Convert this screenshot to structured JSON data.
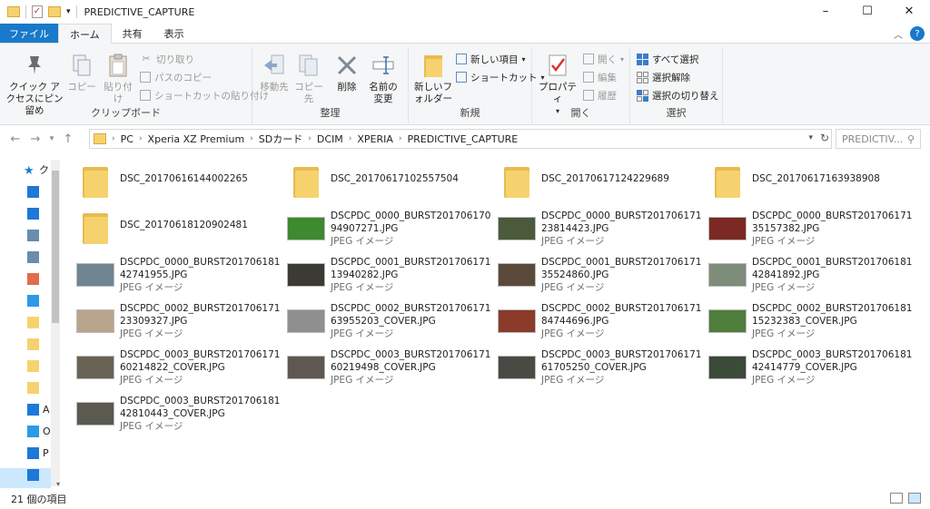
{
  "window": {
    "title": "PREDICTIVE_CAPTURE",
    "controls": [
      "–",
      "☐",
      "✕"
    ]
  },
  "ribbon_tabs": [
    "ファイル",
    "ホーム",
    "共有",
    "表示"
  ],
  "ribbon": {
    "clipboard": {
      "label": "クリップボード",
      "pin": "クイック アクセスにピン留め",
      "copy": "コピー",
      "paste": "貼り付け",
      "cut": "切り取り",
      "copy_path": "パスのコピー",
      "paste_shortcut": "ショートカットの貼り付け"
    },
    "organize": {
      "label": "整理",
      "move_to": "移動先",
      "copy_to": "コピー先",
      "delete": "削除",
      "rename": "名前の変更"
    },
    "new": {
      "label": "新規",
      "new_folder": "新しいフォルダー",
      "new_item": "新しい項目",
      "shortcut": "ショートカット"
    },
    "open": {
      "label": "開く",
      "properties": "プロパティ",
      "open": "開く",
      "edit": "編集",
      "history": "履歴"
    },
    "select": {
      "label": "選択",
      "select_all": "すべて選択",
      "select_none": "選択解除",
      "invert": "選択の切り替え"
    }
  },
  "address": {
    "crumbs": [
      "PC",
      "Xperia XZ Premium",
      "SDカード",
      "DCIM",
      "XPERIA",
      "PREDICTIVE_CAPTURE"
    ],
    "search_placeholder": "PREDICTIV..."
  },
  "navpane": {
    "items": [
      {
        "icon": "star-icon",
        "label": "ク",
        "color": "#1e78d7"
      },
      {
        "icon": "desktop-icon",
        "label": "",
        "color": "#1e78d7"
      },
      {
        "icon": "download-icon",
        "label": "",
        "color": "#1e78d7"
      },
      {
        "icon": "document-icon",
        "label": "",
        "color": "#6a8cad"
      },
      {
        "icon": "pictures-icon",
        "label": "",
        "color": "#6a8cad"
      },
      {
        "icon": "photos-icon",
        "label": "",
        "color": "#e26b4b"
      },
      {
        "icon": "onedrive-icon",
        "label": "",
        "color": "#2b9be6"
      },
      {
        "icon": "folder-icon",
        "label": "",
        "color": "#f6d26f"
      },
      {
        "icon": "folder-icon",
        "label": "",
        "color": "#f6d26f"
      },
      {
        "icon": "folder-icon",
        "label": "",
        "color": "#f6d26f"
      },
      {
        "icon": "folder-icon",
        "label": "",
        "color": "#f6d26f"
      },
      {
        "icon": "a-icon",
        "label": "A",
        "color": "#1e78d7"
      },
      {
        "icon": "cloud-icon",
        "label": "O",
        "color": "#2b9be6"
      },
      {
        "icon": "pc-icon",
        "label": "P",
        "color": "#1e78d7"
      },
      {
        "icon": "phone-icon",
        "label": "",
        "color": "#1e78d7"
      }
    ]
  },
  "files": [
    {
      "name": "DSC_20170616144002265",
      "type": "",
      "kind": "folder"
    },
    {
      "name": "DSC_20170617102557504",
      "type": "",
      "kind": "folder"
    },
    {
      "name": "DSC_20170617124229689",
      "type": "",
      "kind": "folder"
    },
    {
      "name": "DSC_20170617163938908",
      "type": "",
      "kind": "folder"
    },
    {
      "name": "DSC_20170618120902481",
      "type": "",
      "kind": "folder"
    },
    {
      "name": "DSCPDC_0000_BURST20170617094907271.JPG",
      "type": "JPEG イメージ",
      "kind": "photo",
      "color": "#3d8a2f"
    },
    {
      "name": "DSCPDC_0000_BURST20170617123814423.JPG",
      "type": "JPEG イメージ",
      "kind": "photo",
      "color": "#4a5a3a"
    },
    {
      "name": "DSCPDC_0000_BURST20170617135157382.JPG",
      "type": "JPEG イメージ",
      "kind": "photo",
      "color": "#7a2a22"
    },
    {
      "name": "DSCPDC_0000_BURST20170618142741955.JPG",
      "type": "JPEG イメージ",
      "kind": "photo",
      "color": "#6f8592"
    },
    {
      "name": "DSCPDC_0001_BURST20170617113940282.JPG",
      "type": "JPEG イメージ",
      "kind": "photo",
      "color": "#3b3a35"
    },
    {
      "name": "DSCPDC_0001_BURST20170617135524860.JPG",
      "type": "JPEG イメージ",
      "kind": "photo",
      "color": "#5b4a3a"
    },
    {
      "name": "DSCPDC_0001_BURST20170618142841892.JPG",
      "type": "JPEG イメージ",
      "kind": "photo",
      "color": "#7d8d7a"
    },
    {
      "name": "DSCPDC_0002_BURST20170617123309327.JPG",
      "type": "JPEG イメージ",
      "kind": "photo",
      "color": "#b9a58c"
    },
    {
      "name": "DSCPDC_0002_BURST20170617163955203_COVER.JPG",
      "type": "JPEG イメージ",
      "kind": "photo",
      "color": "#8f8f8f"
    },
    {
      "name": "DSCPDC_0002_BURST20170617184744696.JPG",
      "type": "JPEG イメージ",
      "kind": "photo",
      "color": "#8a3b2a"
    },
    {
      "name": "DSCPDC_0002_BURST20170618115232383_COVER.JPG",
      "type": "JPEG イメージ",
      "kind": "photo",
      "color": "#4f7d3c"
    },
    {
      "name": "DSCPDC_0003_BURST20170617160214822_COVER.JPG",
      "type": "JPEG イメージ",
      "kind": "photo",
      "color": "#6b6256"
    },
    {
      "name": "DSCPDC_0003_BURST20170617160219498_COVER.JPG",
      "type": "JPEG イメージ",
      "kind": "photo",
      "color": "#5e5851"
    },
    {
      "name": "DSCPDC_0003_BURST20170617161705250_COVER.JPG",
      "type": "JPEG イメージ",
      "kind": "photo",
      "color": "#4a4a44"
    },
    {
      "name": "DSCPDC_0003_BURST20170618142414779_COVER.JPG",
      "type": "JPEG イメージ",
      "kind": "photo",
      "color": "#3c4a3a"
    },
    {
      "name": "DSCPDC_0003_BURST20170618142810443_COVER.JPG",
      "type": "JPEG イメージ",
      "kind": "photo",
      "color": "#5a5a50"
    }
  ],
  "status": {
    "count": "21 個の項目"
  },
  "colors": {
    "accent": "#1979ca",
    "folder": "#f6d26f"
  }
}
